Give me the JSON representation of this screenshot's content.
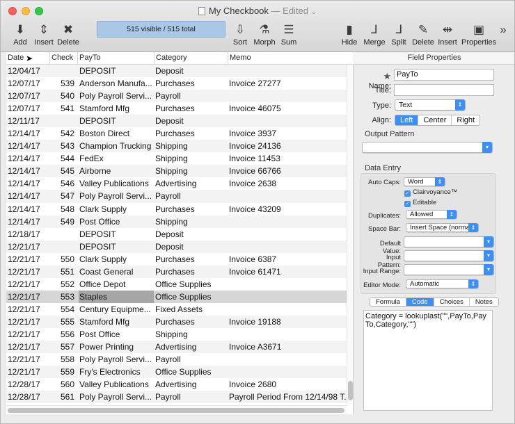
{
  "window": {
    "title": "My Checkbook",
    "edited": "— Edited"
  },
  "toolbar": {
    "add": "Add",
    "insert": "Insert",
    "delete": "Delete",
    "status": "515 visible / 515 total",
    "sort": "Sort",
    "morph": "Morph",
    "sum": "Sum",
    "hide": "Hide",
    "merge": "Merge",
    "split": "Split",
    "delete2": "Delete",
    "insert2": "Insert",
    "properties": "Properties",
    "overflow": "»"
  },
  "table": {
    "headers": {
      "date": "Date",
      "check": "Check",
      "payto": "PayTo",
      "category": "Category",
      "memo": "Memo"
    },
    "rows": [
      {
        "date": "12/04/17",
        "check": "",
        "payto": "DEPOSIT",
        "category": "Deposit",
        "memo": ""
      },
      {
        "date": "12/07/17",
        "check": "539",
        "payto": "Anderson Manufa...",
        "category": "Purchases",
        "memo": "Invoice 27277"
      },
      {
        "date": "12/07/17",
        "check": "540",
        "payto": "Poly Payroll Servi...",
        "category": "Payroll",
        "memo": ""
      },
      {
        "date": "12/07/17",
        "check": "541",
        "payto": "Stamford Mfg",
        "category": "Purchases",
        "memo": "Invoice 46075"
      },
      {
        "date": "12/11/17",
        "check": "",
        "payto": "DEPOSIT",
        "category": "Deposit",
        "memo": ""
      },
      {
        "date": "12/14/17",
        "check": "542",
        "payto": "Boston Direct",
        "category": "Purchases",
        "memo": "Invoice 3937"
      },
      {
        "date": "12/14/17",
        "check": "543",
        "payto": "Champion Trucking",
        "category": "Shipping",
        "memo": "Invoice 24136"
      },
      {
        "date": "12/14/17",
        "check": "544",
        "payto": "FedEx",
        "category": "Shipping",
        "memo": "Invoice 11453"
      },
      {
        "date": "12/14/17",
        "check": "545",
        "payto": "Airborne",
        "category": "Shipping",
        "memo": "Invoice 66766"
      },
      {
        "date": "12/14/17",
        "check": "546",
        "payto": "Valley Publications",
        "category": "Advertising",
        "memo": "Invoice 2638"
      },
      {
        "date": "12/14/17",
        "check": "547",
        "payto": "Poly Payroll Servi...",
        "category": "Payroll",
        "memo": ""
      },
      {
        "date": "12/14/17",
        "check": "548",
        "payto": "Clark Supply",
        "category": "Purchases",
        "memo": "Invoice 43209"
      },
      {
        "date": "12/14/17",
        "check": "549",
        "payto": "Post Office",
        "category": "Shipping",
        "memo": ""
      },
      {
        "date": "12/18/17",
        "check": "",
        "payto": "DEPOSIT",
        "category": "Deposit",
        "memo": ""
      },
      {
        "date": "12/21/17",
        "check": "",
        "payto": "DEPOSIT",
        "category": "Deposit",
        "memo": ""
      },
      {
        "date": "12/21/17",
        "check": "550",
        "payto": "Clark Supply",
        "category": "Purchases",
        "memo": "Invoice 6387"
      },
      {
        "date": "12/21/17",
        "check": "551",
        "payto": "Coast General",
        "category": "Purchases",
        "memo": "Invoice 61471"
      },
      {
        "date": "12/21/17",
        "check": "552",
        "payto": "Office Depot",
        "category": "Office Supplies",
        "memo": ""
      },
      {
        "date": "12/21/17",
        "check": "553",
        "payto": "Staples",
        "category": "Office Supplies",
        "memo": "",
        "selected": true
      },
      {
        "date": "12/21/17",
        "check": "554",
        "payto": "Century Equipme...",
        "category": "Fixed Assets",
        "memo": ""
      },
      {
        "date": "12/21/17",
        "check": "555",
        "payto": "Stamford Mfg",
        "category": "Purchases",
        "memo": "Invoice 19188"
      },
      {
        "date": "12/21/17",
        "check": "556",
        "payto": "Post Office",
        "category": "Shipping",
        "memo": ""
      },
      {
        "date": "12/21/17",
        "check": "557",
        "payto": "Power Printing",
        "category": "Advertising",
        "memo": "Invoice A3671"
      },
      {
        "date": "12/21/17",
        "check": "558",
        "payto": "Poly Payroll Servi...",
        "category": "Payroll",
        "memo": ""
      },
      {
        "date": "12/21/17",
        "check": "559",
        "payto": "Fry's Electronics",
        "category": "Office Supplies",
        "memo": ""
      },
      {
        "date": "12/28/17",
        "check": "560",
        "payto": "Valley Publications",
        "category": "Advertising",
        "memo": "Invoice 2680"
      },
      {
        "date": "12/28/17",
        "check": "561",
        "payto": "Poly Payroll Servi...",
        "category": "Payroll",
        "memo": "Payroll Period From 12/14/98 T..."
      }
    ]
  },
  "panel": {
    "title": "Field Properties",
    "name_label": "Name:",
    "name_value": "PayTo",
    "title_label": "Title:",
    "title_value": "",
    "type_label": "Type:",
    "type_value": "Text",
    "align_label": "Align:",
    "align_left": "Left",
    "align_center": "Center",
    "align_right": "Right",
    "output_pattern": "Output Pattern",
    "data_entry": "Data Entry",
    "auto_caps_label": "Auto Caps:",
    "auto_caps_value": "Word",
    "clairvoyance": "Clairvoyance™",
    "editable": "Editable",
    "duplicates_label": "Duplicates:",
    "duplicates_value": "Allowed",
    "spacebar_label": "Space Bar:",
    "spacebar_value": "Insert Space (normal)",
    "default_label": "Default Value:",
    "input_pattern_label": "Input Pattern:",
    "input_range_label": "Input Range:",
    "editor_mode_label": "Editor Mode:",
    "editor_mode_value": "Automatic",
    "tabs": [
      "Formula",
      "Code",
      "Choices",
      "Notes"
    ],
    "code": "Category = lookuplast(\"\",PayTo,PayTo,Category,\"\")"
  }
}
